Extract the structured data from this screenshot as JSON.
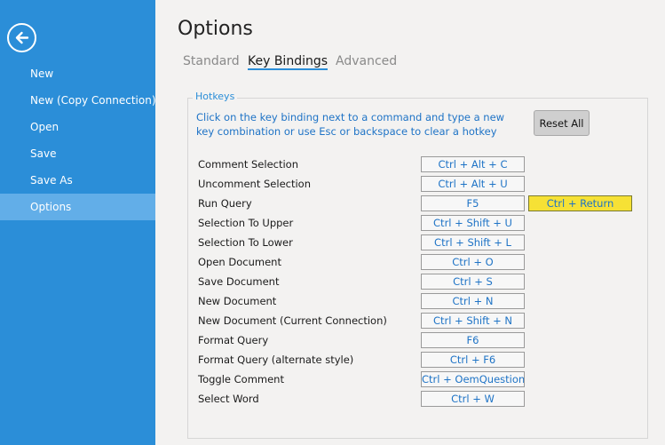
{
  "sidebar": {
    "items": [
      {
        "label": "New"
      },
      {
        "label": "New (Copy Connection)"
      },
      {
        "label": "Open"
      },
      {
        "label": "Save"
      },
      {
        "label": "Save As"
      },
      {
        "label": "Options"
      }
    ],
    "active": "Options"
  },
  "header": {
    "title": "Options",
    "tabs": [
      {
        "label": "Standard"
      },
      {
        "label": "Key Bindings"
      },
      {
        "label": "Advanced"
      }
    ],
    "active_tab": "Key Bindings"
  },
  "hotkeys": {
    "legend": "Hotkeys",
    "description": "Click on the key binding next to a command and type a new key combination or use Esc or backspace to clear a hotkey",
    "reset_label": "Reset All",
    "rows": [
      {
        "command": "Comment Selection",
        "key": "Ctrl + Alt + C"
      },
      {
        "command": "Uncomment Selection",
        "key": "Ctrl + Alt + U"
      },
      {
        "command": "Run Query",
        "key": "F5",
        "key2": "Ctrl + Return"
      },
      {
        "command": "Selection To Upper",
        "key": "Ctrl + Shift + U"
      },
      {
        "command": "Selection To Lower",
        "key": "Ctrl + Shift + L"
      },
      {
        "command": "Open Document",
        "key": "Ctrl + O"
      },
      {
        "command": "Save Document",
        "key": "Ctrl + S"
      },
      {
        "command": "New Document",
        "key": "Ctrl + N"
      },
      {
        "command": "New Document (Current Connection)",
        "key": "Ctrl + Shift + N"
      },
      {
        "command": "Format Query",
        "key": "F6"
      },
      {
        "command": "Format Query (alternate style)",
        "key": "Ctrl + F6"
      },
      {
        "command": "Toggle Comment",
        "key": "Ctrl + OemQuestion"
      },
      {
        "command": "Select Word",
        "key": "Ctrl + W"
      }
    ]
  },
  "colors": {
    "sidebar_bg": "#2b8ed8",
    "sidebar_active": "#62aee8",
    "accent_text": "#1e73c6",
    "highlight_key": "#f6e135"
  },
  "icons": {
    "back": "arrow-left-circle-icon"
  }
}
